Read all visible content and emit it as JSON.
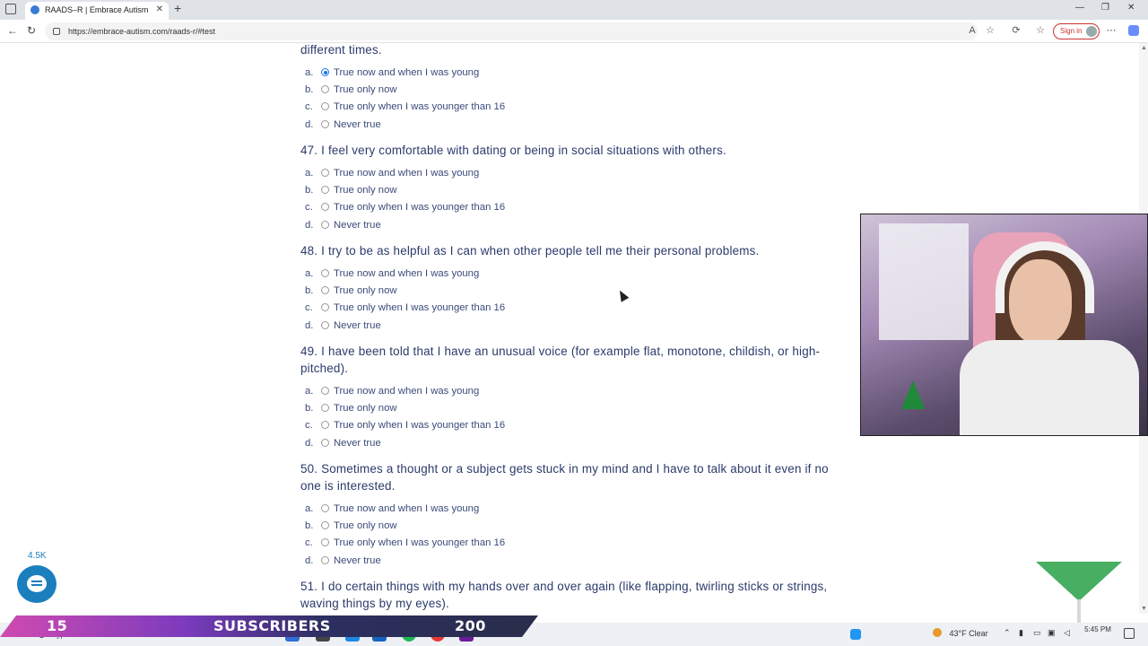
{
  "browser": {
    "tab_title": "RAADS–R | Embrace Autism",
    "tab_close": "✕",
    "new_tab": "+",
    "url": "https://embrace-autism.com/raads-r/#test",
    "sign_in": "Sign in",
    "back": "←",
    "refresh": "↻",
    "minimize": "—",
    "restore": "❐",
    "close": "✕",
    "more": "⋯"
  },
  "partial_question": {
    "tail": "different times."
  },
  "answer_letters": [
    "a.",
    "b.",
    "c.",
    "d."
  ],
  "answer_options": [
    "True now and when I was young",
    "True only now",
    "True only when I was younger than 16",
    "Never true"
  ],
  "questions": [
    {
      "number": "",
      "text": "different times.",
      "selected": 0
    },
    {
      "number": "47.",
      "text": "I feel very comfortable with dating or being in social situations with others.",
      "selected": -1
    },
    {
      "number": "48.",
      "text": "I try to be as helpful as I can when other people tell me their personal problems.",
      "selected": -1
    },
    {
      "number": "49.",
      "text": "I have been told that I have an unusual voice (for example flat, monotone, childish, or high-pitched).",
      "selected": -1
    },
    {
      "number": "50.",
      "text": "Sometimes a thought or a subject gets stuck in my mind and I have to talk about it even if no one is interested.",
      "selected": -1
    },
    {
      "number": "51.",
      "text": "I do certain things with my hands over and over again (like flapping, twirling sticks or strings, waving things by my eyes).",
      "selected": -1
    }
  ],
  "chat_widget": {
    "count": "4.5K"
  },
  "stream_overlay": {
    "left_number": "15",
    "label": "SUBSCRIBERS",
    "right_number": "200"
  },
  "taskbar": {
    "search_placeholder": "Type here to search",
    "weather": "43°F  Clear",
    "time": "5:45 PM"
  }
}
